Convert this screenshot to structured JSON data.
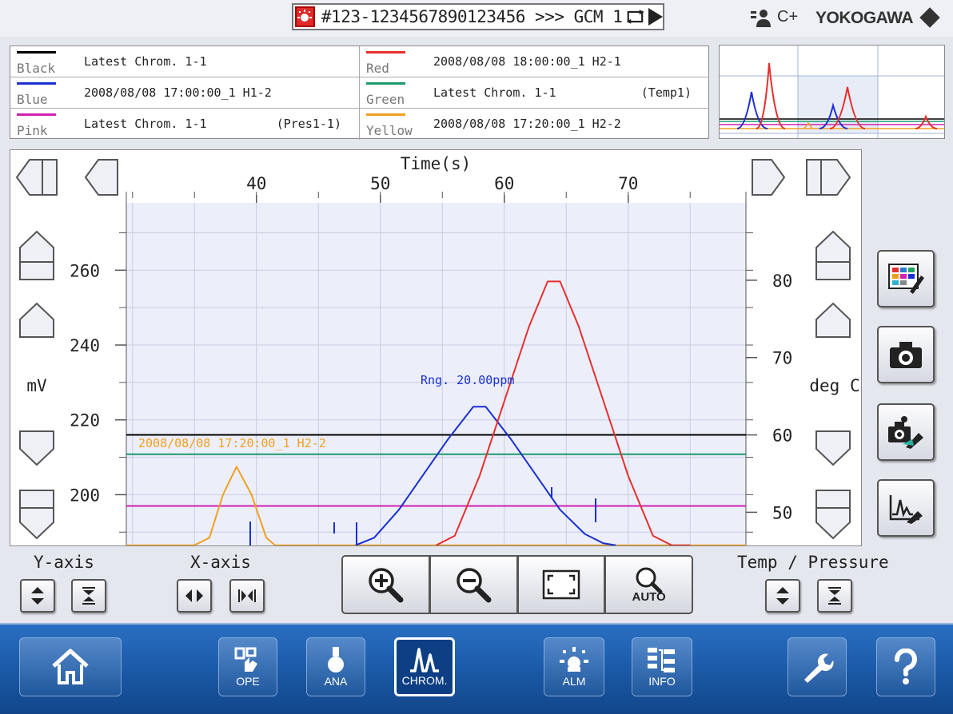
{
  "header": {
    "analyzer_id": "#123-1234567890123456 >>> GCM 1",
    "user_level": "C+",
    "brand": "YOKOGAWA"
  },
  "legend": [
    {
      "color_name": "Black",
      "color": "#000000",
      "description": "Latest Chrom. 1-1",
      "suffix": ""
    },
    {
      "color_name": "Red",
      "color": "#e53030",
      "description": "2008/08/08 18:00:00_1 H2-1",
      "suffix": ""
    },
    {
      "color_name": "Blue",
      "color": "#1c2fd0",
      "description": "2008/08/08 17:00:00_1 H1-2",
      "suffix": ""
    },
    {
      "color_name": "Green",
      "color": "#1a9a6a",
      "description": "Latest Chrom. 1-1",
      "suffix": "(Temp1)"
    },
    {
      "color_name": "Pink",
      "color": "#d020b0",
      "description": "Latest Chrom. 1-1",
      "suffix": "(Pres1-1)"
    },
    {
      "color_name": "Yellow",
      "color": "#f0a020",
      "description": "2008/08/08 17:20:00_1 H2-2",
      "suffix": ""
    }
  ],
  "chart": {
    "x_title": "Time(s)",
    "x_ticks": [
      "40",
      "50",
      "60",
      "70"
    ],
    "y_left_unit": "mV",
    "y_left_ticks": [
      "260",
      "240",
      "220",
      "200"
    ],
    "y_right_unit": "deg C",
    "y_right_ticks": [
      "80",
      "70",
      "60",
      "50"
    ],
    "annotation_blue": "Rng. 20.00ppm",
    "annotation_yellow": "2008/08/08 17:20:00_1 H2-2"
  },
  "chart_data": {
    "type": "line",
    "xlabel": "Time(s)",
    "ylabel": "mV",
    "y2label": "deg C",
    "xlim": [
      29.5,
      79.5
    ],
    "ylim": [
      186,
      278
    ],
    "y2lim": [
      45.5,
      90
    ],
    "x_ticks": [
      40,
      50,
      60,
      70
    ],
    "y_ticks": [
      200,
      220,
      240,
      260
    ],
    "y2_ticks": [
      50,
      60,
      70,
      80
    ],
    "grid": true,
    "series": [
      {
        "name": "Black",
        "color": "#000000",
        "axis": "left",
        "x": [
          29.5,
          79.5
        ],
        "y": [
          216,
          216
        ]
      },
      {
        "name": "Green",
        "color": "#1a9a6a",
        "axis": "right",
        "x": [
          29.5,
          79.5
        ],
        "y": [
          57.5,
          57.5
        ]
      },
      {
        "name": "Pink",
        "color": "#d020b0",
        "axis": "left",
        "x": [
          29.5,
          79.5
        ],
        "y": [
          197,
          197
        ]
      },
      {
        "name": "Yellow",
        "color": "#f0a020",
        "axis": "left",
        "x": [
          29.5,
          35.0,
          36.2,
          37.3,
          38.4,
          39.6,
          40.8,
          41.5,
          79.5
        ],
        "y": [
          186.5,
          186.5,
          188.5,
          200.0,
          207.5,
          200.0,
          188.5,
          186.5,
          186.5
        ]
      },
      {
        "name": "Blue",
        "color": "#1c2fd0",
        "axis": "left",
        "x": [
          48.0,
          49.5,
          51.5,
          53.5,
          55.5,
          57.5,
          58.5,
          60.5,
          62.5,
          64.5,
          66.5,
          68.0,
          69.0
        ],
        "y": [
          186.5,
          188.5,
          196.0,
          205.5,
          215.0,
          223.5,
          223.5,
          215.0,
          205.5,
          196.0,
          189.5,
          187.0,
          186.5
        ]
      },
      {
        "name": "Red",
        "color": "#e53030",
        "axis": "left",
        "x": [
          54.5,
          56.0,
          58.0,
          60.0,
          62.0,
          63.5,
          64.5,
          66.0,
          68.0,
          70.0,
          72.0,
          73.5,
          75.0
        ],
        "y": [
          186.5,
          189.0,
          205.0,
          225.0,
          245.0,
          257.0,
          257.0,
          245.0,
          225.0,
          205.0,
          189.0,
          186.5,
          186.5
        ]
      }
    ]
  },
  "controls": {
    "y_axis_label": "Y-axis",
    "x_axis_label": "X-axis",
    "temp_label": "Temp / Pressure",
    "auto_label": "AUTO"
  },
  "nav": {
    "ope": "OPE",
    "ana": "ANA",
    "chrom": "CHROM.",
    "alm": "ALM",
    "info": "INFO"
  }
}
